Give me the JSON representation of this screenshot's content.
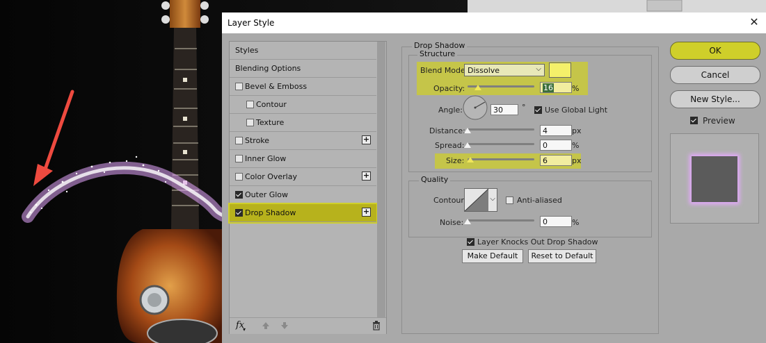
{
  "dialog": {
    "title": "Layer Style",
    "close": "✕"
  },
  "styles_panel": {
    "header": "Styles",
    "items": [
      {
        "label": "Blending Options",
        "has_checkbox": false,
        "checked": false,
        "has_plus": false
      },
      {
        "label": "Bevel & Emboss",
        "has_checkbox": true,
        "checked": false,
        "has_plus": false
      },
      {
        "label": "Contour",
        "has_checkbox": true,
        "checked": false,
        "has_plus": false
      },
      {
        "label": "Texture",
        "has_checkbox": true,
        "checked": false,
        "has_plus": false
      },
      {
        "label": "Stroke",
        "has_checkbox": true,
        "checked": false,
        "has_plus": true
      },
      {
        "label": "Inner Glow",
        "has_checkbox": true,
        "checked": false,
        "has_plus": false
      },
      {
        "label": "Color Overlay",
        "has_checkbox": true,
        "checked": false,
        "has_plus": true
      },
      {
        "label": "Outer Glow",
        "has_checkbox": true,
        "checked": true,
        "has_plus": false
      },
      {
        "label": "Drop Shadow",
        "has_checkbox": true,
        "checked": true,
        "has_plus": true,
        "selected": true
      }
    ],
    "footer": {
      "fx": "fx",
      "up_icon": "arrow-up-icon",
      "down_icon": "arrow-down-icon",
      "trash_icon": "trash-icon"
    },
    "plus": "+"
  },
  "drop_shadow": {
    "title": "Drop Shadow",
    "structure": {
      "legend": "Structure",
      "blend_mode_label": "Blend Mode:",
      "blend_mode_value": "Dissolve",
      "shadow_color": "#f5f06a",
      "opacity_label": "Opacity:",
      "opacity_value": "16",
      "opacity_unit": "%",
      "opacity_level": 0.16,
      "angle_label": "Angle:",
      "angle_value": "30",
      "angle_unit": "°",
      "use_global_light_label": "Use Global Light",
      "use_global_light": true,
      "distance_label": "Distance:",
      "distance_value": "4",
      "distance_unit": "px",
      "distance_level": 0.0,
      "spread_label": "Spread:",
      "spread_value": "0",
      "spread_unit": "%",
      "spread_level": 0.0,
      "size_label": "Size:",
      "size_value": "6",
      "size_unit": "px",
      "size_level": 0.04
    },
    "quality": {
      "legend": "Quality",
      "contour_label": "Contour:",
      "anti_aliased_label": "Anti-aliased",
      "anti_aliased": false,
      "noise_label": "Noise:",
      "noise_value": "0",
      "noise_unit": "%",
      "noise_level": 0.0
    },
    "layer_knocks_label": "Layer Knocks Out Drop Shadow",
    "layer_knocks": true,
    "make_default": "Make Default",
    "reset_default": "Reset to Default"
  },
  "buttons": {
    "ok": "OK",
    "cancel": "Cancel",
    "new_style": "New Style...",
    "preview_label": "Preview",
    "preview_checked": true
  },
  "colors": {
    "highlight": "#cfcf2a",
    "glow": "#e6a8ff",
    "arrow": "#ee4a3f"
  }
}
